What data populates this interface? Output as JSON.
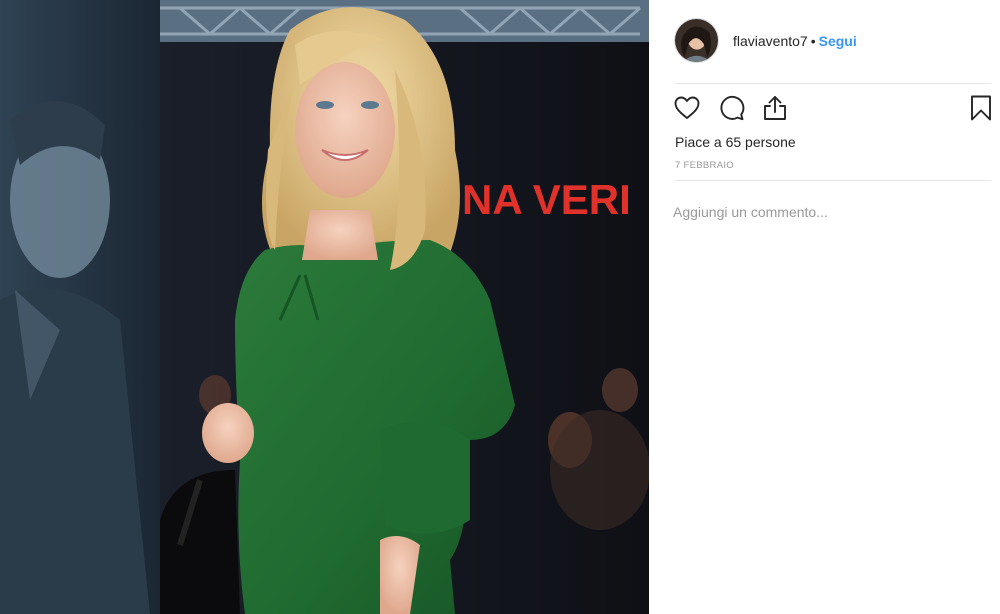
{
  "post": {
    "photo_icon": "photo",
    "photo_sign_text": "NA VERI",
    "photo_colors": {
      "dress": "#2d7a3c",
      "hair": "#e2c78c",
      "sign": "#e0322a"
    }
  },
  "header": {
    "avatar_icon": "avatar",
    "username": "flaviavento7",
    "separator": "•",
    "follow_label": "Segui",
    "follow_color": "#3897f0"
  },
  "actions": {
    "like_icon": "heart-icon",
    "comment_icon": "comment-icon",
    "share_icon": "share-icon",
    "save_icon": "bookmark-icon"
  },
  "stats": {
    "likes_text": "Piace a 65 persone",
    "date": "7 FEBBRAIO"
  },
  "comment": {
    "placeholder": "Aggiungi un commento..."
  }
}
